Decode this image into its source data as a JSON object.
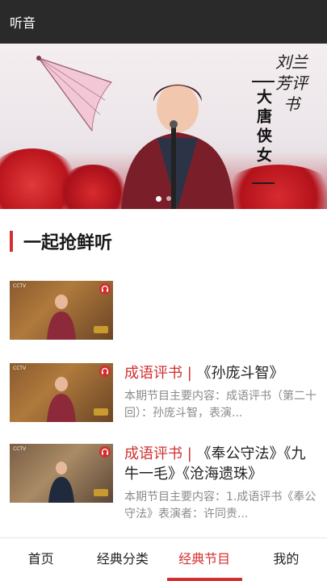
{
  "app": {
    "title": "听音"
  },
  "banner": {
    "calligraphy": "刘兰芳评书",
    "boxed_title": "大唐侠女",
    "page_indicator": {
      "count": 2,
      "active": 1
    }
  },
  "section": {
    "title": "一起抢鲜听"
  },
  "items": [
    {
      "category": "",
      "title": "",
      "desc": ""
    },
    {
      "category": "成语评书 |",
      "title": "《孙庞斗智》",
      "desc": "本期节目主要内容：成语评书（第二十回）：孙庞斗智，表演..."
    },
    {
      "category": "成语评书 |",
      "title": "《奉公守法》《九牛一毛》《沧海遗珠》",
      "desc": "本期节目主要内容：1.成语评书《奉公守法》表演者：许同贵..."
    }
  ],
  "tabs": [
    {
      "label": "首页",
      "active": false
    },
    {
      "label": "经典分类",
      "active": false
    },
    {
      "label": "经典节目",
      "active": true
    },
    {
      "label": "我的",
      "active": false
    }
  ],
  "colors": {
    "accent": "#d32f2f",
    "appbar": "#2a2a2a"
  }
}
